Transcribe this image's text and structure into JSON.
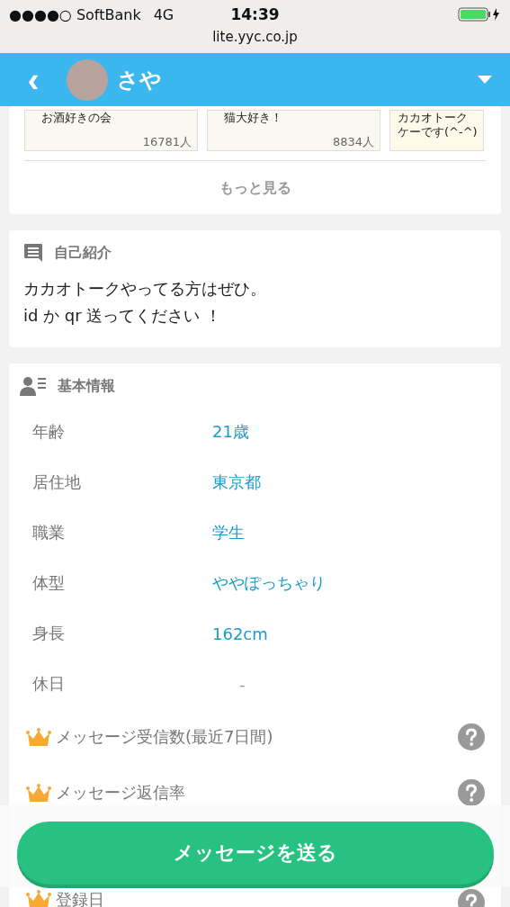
{
  "status_bar": {
    "carrier": "●●●●○ SoftBank",
    "network": "4G",
    "time": "14:39"
  },
  "url_bar": {
    "url": "lite.yyc.co.jp"
  },
  "header": {
    "back": "‹",
    "name": "さや"
  },
  "communities": {
    "cards": [
      {
        "title": [
          "お酒好きの会"
        ],
        "count": "16781人"
      },
      {
        "title": [
          "猫大好き！"
        ],
        "count": "8834人"
      },
      {
        "title": [
          "カカオトーク",
          "ケーです(^-^)"
        ]
      }
    ],
    "more": "もっと見る"
  },
  "intro": {
    "heading": "自己紹介",
    "lines": [
      "カカオトークやってる方はぜひ。",
      "id か qr 送ってください ！"
    ]
  },
  "basic_info": {
    "heading": "基本情報",
    "rows": [
      {
        "kind": "field",
        "label": "年齢",
        "value": "21歳",
        "muted": false
      },
      {
        "kind": "field",
        "label": "居住地",
        "value": "東京都",
        "muted": false
      },
      {
        "kind": "field",
        "label": "職業",
        "value": "学生",
        "muted": false
      },
      {
        "kind": "field",
        "label": "体型",
        "value": "ややぽっちゃり",
        "muted": false
      },
      {
        "kind": "field",
        "label": "身長",
        "value": "162cm",
        "muted": false
      },
      {
        "kind": "field",
        "label": "休日",
        "value": "-",
        "muted": true
      },
      {
        "kind": "premium",
        "label": "メッセージ受信数(最近7日間)"
      },
      {
        "kind": "premium",
        "label": "メッセージ返信率"
      },
      {
        "kind": "premium",
        "label": "登録日"
      }
    ]
  },
  "send_button": "メッセージを送る"
}
